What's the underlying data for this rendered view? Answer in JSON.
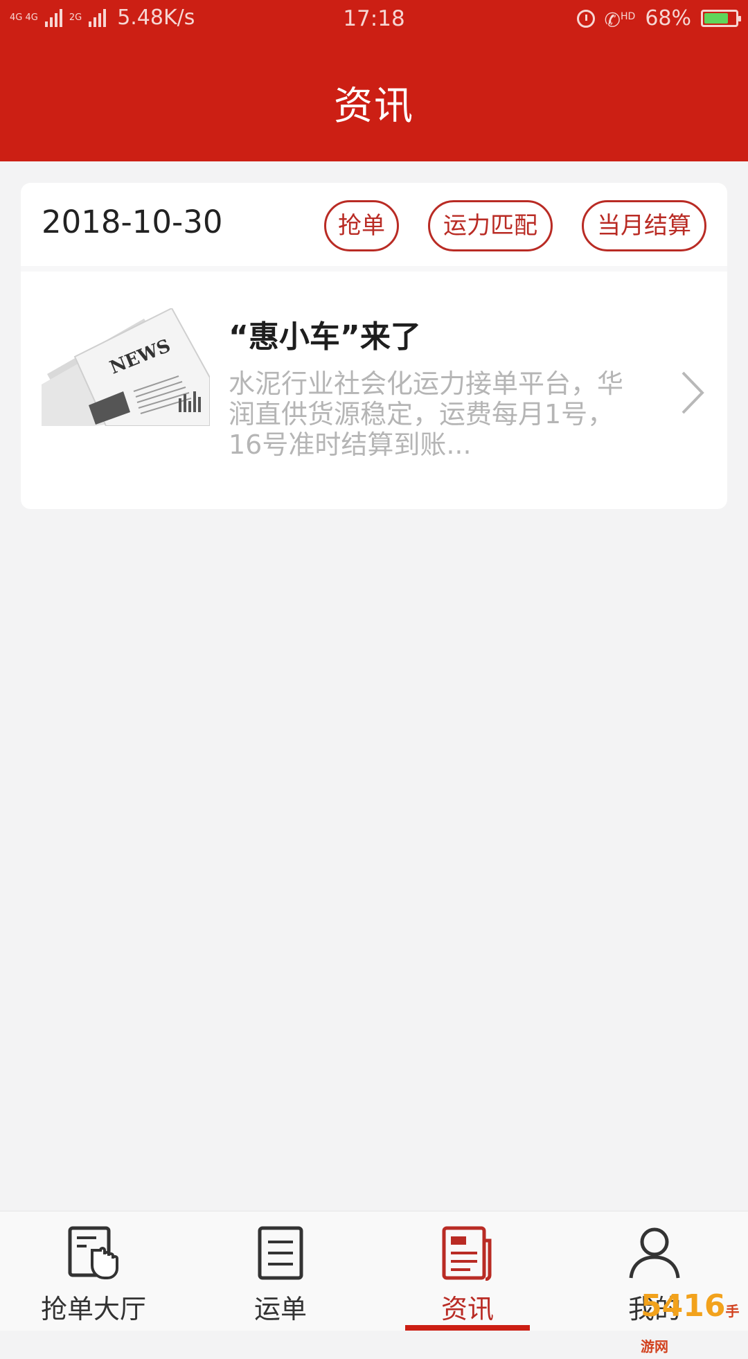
{
  "status_bar": {
    "network_1": "4G 4G",
    "network_2": "2G",
    "speed": "5.48K/s",
    "time": "17:18",
    "call_label": "HD",
    "battery": "68%"
  },
  "header": {
    "title": "资讯"
  },
  "card": {
    "date": "2018-10-30",
    "tags": [
      "抢单",
      "运力匹配",
      "当月结算"
    ],
    "news": {
      "title": "“惠小车”来了",
      "description": "水泥行业社会化运力接单平台，华润直供货源稳定，运费每月1号，16号准时结算到账...",
      "thumb_text": "NEWS"
    }
  },
  "bottom_nav": {
    "items": [
      {
        "label": "抢单大厅",
        "icon": "hand-tap-icon"
      },
      {
        "label": "运单",
        "icon": "document-list-icon"
      },
      {
        "label": "资讯",
        "icon": "newspaper-icon",
        "active": true
      },
      {
        "label": "我的",
        "icon": "user-icon"
      }
    ]
  },
  "watermark": {
    "text": "5416",
    "sub": "手游网"
  },
  "colors": {
    "brand_red": "#cc1f14",
    "tag_red": "#b92b24",
    "background": "#f3f3f4"
  }
}
